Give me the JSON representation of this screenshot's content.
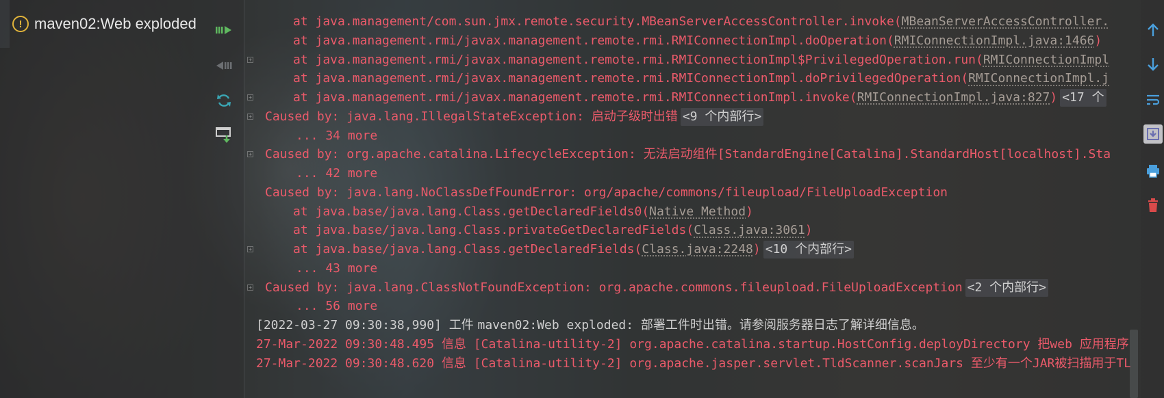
{
  "services": {
    "node_label": "maven02:Web exploded",
    "node_icon": "warning-icon"
  },
  "toolbar_left": {
    "buttons": [
      "run-all-icon",
      "stop-icon",
      "redeploy-icon",
      "deploy-icon"
    ]
  },
  "console": {
    "lines": [
      {
        "indent": 1,
        "parts": [
          {
            "text": "at java.management/com.sun.jmx.remote.security.MBeanServerAccessController.invoke("
          },
          {
            "text": "MBeanServerAccessController.",
            "link": true
          }
        ]
      },
      {
        "indent": 1,
        "parts": [
          {
            "text": "at java.management.rmi/javax.management.remote.rmi.RMIConnectionImpl.doOperation("
          },
          {
            "text": "RMIConnectionImpl.java:1466",
            "link": true
          },
          {
            "text": ")"
          }
        ]
      },
      {
        "indent": 1,
        "fold": true,
        "parts": [
          {
            "text": "at java.management.rmi/javax.management.remote.rmi.RMIConnectionImpl$PrivilegedOperation.run("
          },
          {
            "text": "RMIConnectionImpl",
            "link": true
          }
        ]
      },
      {
        "indent": 1,
        "parts": [
          {
            "text": "at java.management.rmi/javax.management.remote.rmi.RMIConnectionImpl.doPrivilegedOperation("
          },
          {
            "text": "RMIConnectionImpl.j",
            "link": true
          }
        ]
      },
      {
        "indent": 1,
        "fold": true,
        "parts": [
          {
            "text": "at java.management.rmi/javax.management.remote.rmi.RMIConnectionImpl.invoke("
          },
          {
            "text": "RMIConnectionImpl.java:827",
            "link": true
          },
          {
            "text": ")"
          },
          {
            "badge": "<17 个"
          }
        ]
      },
      {
        "indent": 0,
        "fold": true,
        "parts": [
          {
            "text": "Caused by: java.lang.IllegalStateException: "
          },
          {
            "text": "启动子级时出错",
            "cn": true
          },
          {
            "badge": "<9 个内部行>"
          }
        ]
      },
      {
        "indent": 2,
        "parts": [
          {
            "text": "... 34 more"
          }
        ]
      },
      {
        "indent": 0,
        "fold": true,
        "parts": [
          {
            "text": "Caused by: org.apache.catalina.LifecycleException: "
          },
          {
            "text": "无法启动组件",
            "cn": true
          },
          {
            "text": "[StandardEngine[Catalina].StandardHost[localhost].Sta"
          }
        ]
      },
      {
        "indent": 2,
        "parts": [
          {
            "text": "... 42 more"
          }
        ]
      },
      {
        "indent": 0,
        "parts": [
          {
            "text": "Caused by: java.lang.NoClassDefFoundError: org/apache/commons/fileupload/FileUploadException"
          }
        ]
      },
      {
        "indent": 1,
        "parts": [
          {
            "text": "at java.base/java.lang.Class.getDeclaredFields0("
          },
          {
            "text": "Native Method",
            "link": true
          },
          {
            "text": ")"
          }
        ]
      },
      {
        "indent": 1,
        "parts": [
          {
            "text": "at java.base/java.lang.Class.privateGetDeclaredFields("
          },
          {
            "text": "Class.java:3061",
            "link": true
          },
          {
            "text": ")"
          }
        ]
      },
      {
        "indent": 1,
        "fold": true,
        "parts": [
          {
            "text": "at java.base/java.lang.Class.getDeclaredFields("
          },
          {
            "text": "Class.java:2248",
            "link": true
          },
          {
            "text": ")"
          },
          {
            "badge": "<10 个内部行>"
          }
        ]
      },
      {
        "indent": 2,
        "parts": [
          {
            "text": "... 43 more"
          }
        ]
      },
      {
        "indent": 0,
        "fold": true,
        "parts": [
          {
            "text": "Caused by: java.lang.ClassNotFoundException: org.apache.commons.fileupload.FileUploadException"
          },
          {
            "badge": "<2 个内部行>"
          }
        ]
      },
      {
        "indent": 2,
        "parts": [
          {
            "text": "... 56 more"
          }
        ]
      },
      {
        "indent": -1,
        "parts": [
          {
            "text": "[2022-03-27 09:30:38,990] ",
            "gray": true
          },
          {
            "text": "工件 ",
            "cn": true,
            "gray": true
          },
          {
            "text": "maven02:Web exploded: ",
            "gray": true
          },
          {
            "text": "部署工件时出错。请参阅服务器日志了解详细信息。",
            "cn": true,
            "gray": true
          }
        ]
      },
      {
        "indent": -1,
        "parts": [
          {
            "text": "27-Mar-2022 09:30:48.495 "
          },
          {
            "text": "信息",
            "cn": true
          },
          {
            "text": " [Catalina-utility-2] org.apache.catalina.startup.HostConfig.deployDirectory "
          },
          {
            "text": "把",
            "cn": true
          },
          {
            "text": "web "
          },
          {
            "text": "应用程序",
            "cn": true
          }
        ]
      },
      {
        "indent": -1,
        "parts": [
          {
            "text": "27-Mar-2022 09:30:48.620 "
          },
          {
            "text": "信息",
            "cn": true
          },
          {
            "text": " [Catalina-utility-2] org.apache.jasper.servlet.TldScanner.scanJars "
          },
          {
            "text": "至少有一个",
            "cn": true
          },
          {
            "text": "JAR"
          },
          {
            "text": "被扫描用于",
            "cn": true
          },
          {
            "text": "TL"
          }
        ]
      }
    ]
  },
  "toolbar_right": {
    "buttons": [
      "up-arrow-icon",
      "down-arrow-icon",
      "soft-wrap-icon",
      "scroll-to-end-icon",
      "print-icon",
      "clear-all-icon"
    ]
  },
  "colors": {
    "error_text": "#ea5a6a",
    "info_text": "#cfcfcf",
    "link_text": "#a59c95",
    "warning": "#e2b43a",
    "run_green": "#5fb85f",
    "refresh_teal": "#3aa7b5",
    "right_blue": "#4a9fdc",
    "clear_red": "#d94a4a"
  }
}
